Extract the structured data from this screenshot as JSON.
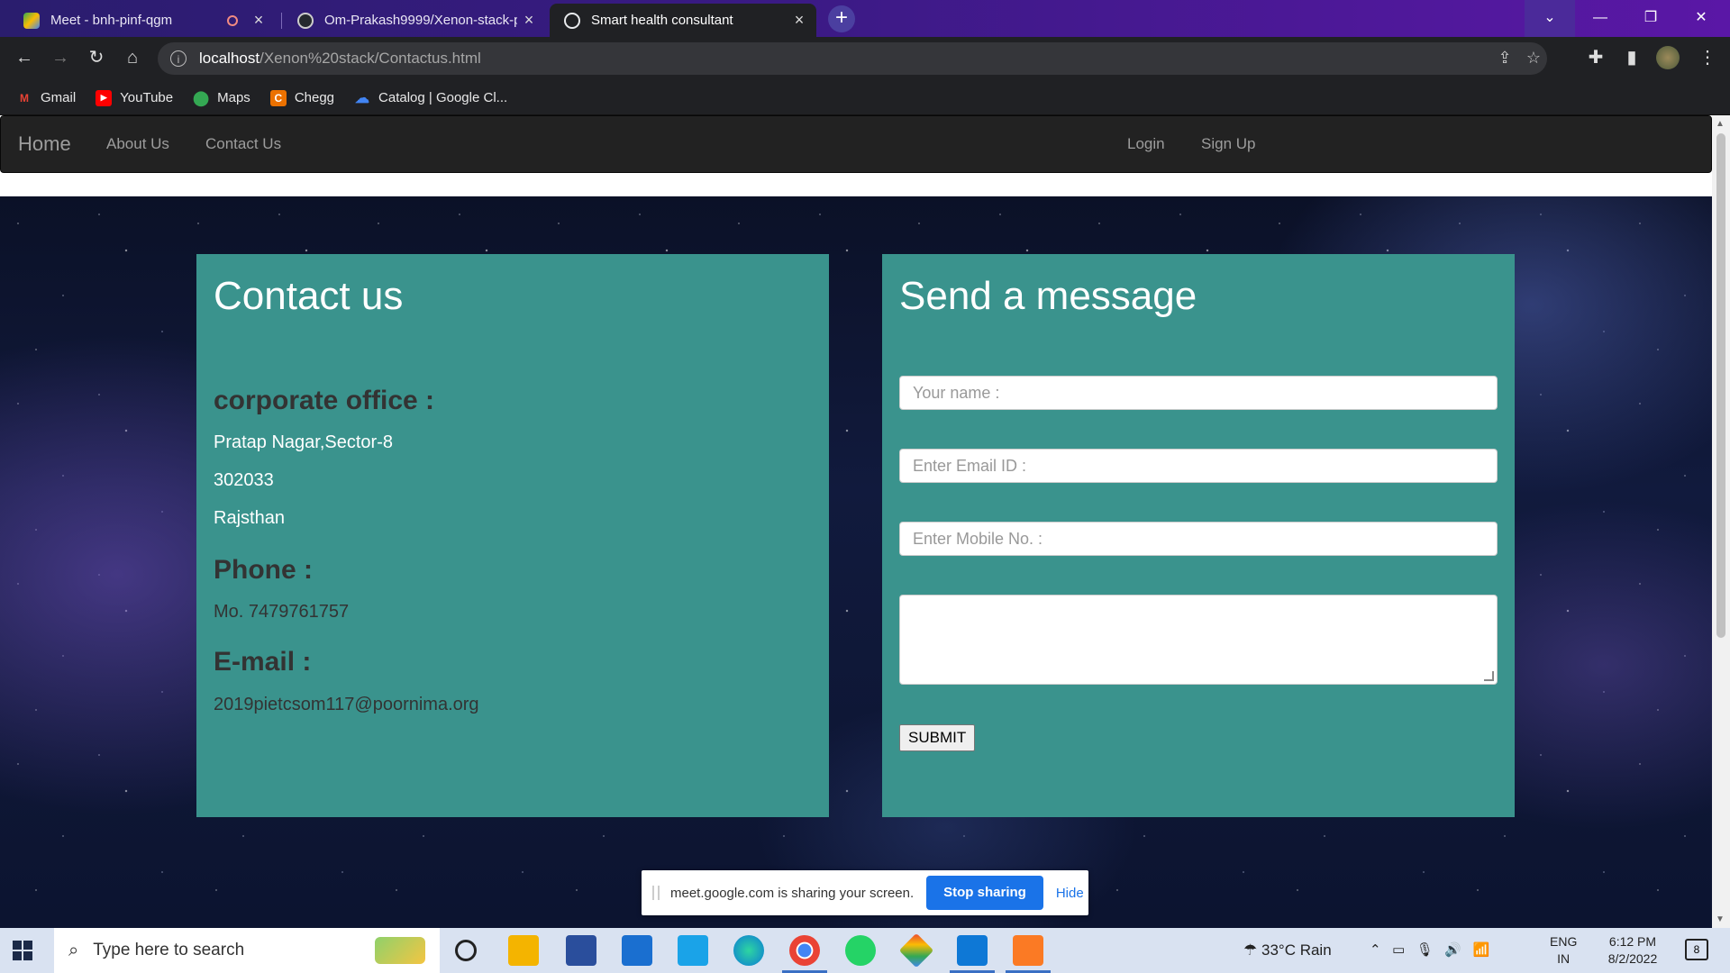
{
  "browser": {
    "tabs": [
      {
        "title": "Meet - bnh-pinf-qgm",
        "favicon_color": "#34a853",
        "active": false
      },
      {
        "title": "Om-Prakash9999/Xenon-stack-p",
        "favicon_color": "#24292e",
        "active": false
      },
      {
        "title": "Smart health consultant",
        "favicon_color": "#e8eaed",
        "active": true
      }
    ],
    "address": {
      "host": "localhost",
      "path": "/Xenon%20stack/Contactus.html"
    },
    "bookmarks": [
      {
        "label": "Gmail",
        "icon": "gmail-icon",
        "color": "#ea4335"
      },
      {
        "label": "YouTube",
        "icon": "youtube-icon",
        "color": "#ff0000"
      },
      {
        "label": "Maps",
        "icon": "maps-icon",
        "color": "#34a853"
      },
      {
        "label": "Chegg",
        "icon": "chegg-icon",
        "color": "#eb7100"
      },
      {
        "label": "Catalog | Google Cl...",
        "icon": "google-cloud-icon",
        "color": "#4285f4"
      }
    ]
  },
  "navbar": {
    "brand": "Home",
    "links": [
      "About Us",
      "Contact Us"
    ],
    "right_links": [
      "Login",
      "Sign Up"
    ]
  },
  "contact": {
    "title": "Contact us",
    "office_heading": "corporate office :",
    "address_lines": [
      "Pratap Nagar,Sector-8",
      "302033",
      "Rajsthan"
    ],
    "phone_heading": "Phone :",
    "phone": "Mo. 7479761757",
    "email_heading": "E-mail :",
    "email": "2019pietcsom117@poornima.org"
  },
  "message": {
    "title": "Send a message",
    "name_placeholder": "Your name :",
    "email_placeholder": "Enter Email ID :",
    "mobile_placeholder": "Enter Mobile No. :",
    "submit": "SUBMIT"
  },
  "share_bar": {
    "text": "meet.google.com is sharing your screen.",
    "stop": "Stop sharing",
    "hide": "Hide"
  },
  "taskbar": {
    "search_placeholder": "Type here to search",
    "weather": "33°C  Rain",
    "lang": "ENG",
    "region": "IN",
    "time": "6:12 PM",
    "date": "8/2/2022",
    "notifications": "8"
  },
  "colors": {
    "panel": "#3a938d",
    "navbar": "#222222",
    "share_button": "#1a73e8"
  }
}
